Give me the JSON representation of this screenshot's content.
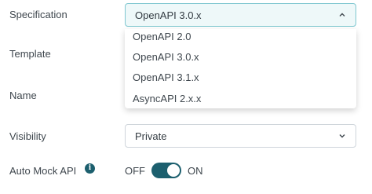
{
  "form": {
    "specification": {
      "label": "Specification",
      "value": "OpenAPI 3.0.x",
      "options": [
        "OpenAPI 2.0",
        "OpenAPI 3.0.x",
        "OpenAPI 3.1.x",
        "AsyncAPI 2.x.x"
      ]
    },
    "template": {
      "label": "Template"
    },
    "name": {
      "label": "Name"
    },
    "visibility": {
      "label": "Visibility",
      "value": "Private"
    },
    "auto_mock": {
      "label": "Auto Mock API",
      "info_icon": "info-icon",
      "off_label": "OFF",
      "on_label": "ON",
      "state": "on"
    }
  },
  "colors": {
    "accent": "#1c5f6e",
    "open_field_bg": "#eef8f9",
    "open_field_border": "#7fc7d0"
  }
}
